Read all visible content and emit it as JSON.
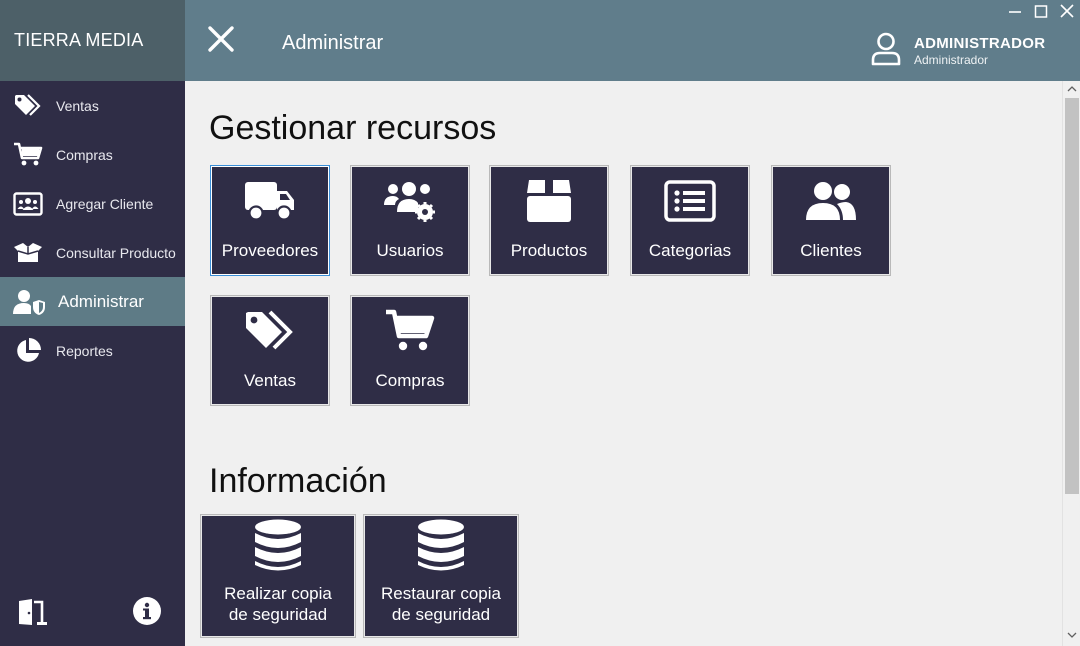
{
  "sidebar": {
    "brand": "TIERRA MEDIA",
    "items": [
      {
        "label": "Ventas",
        "icon": "tags-icon"
      },
      {
        "label": "Compras",
        "icon": "cart-icon"
      },
      {
        "label": "Agregar Cliente",
        "icon": "address-card-icon"
      },
      {
        "label": "Consultar Producto",
        "icon": "open-box-icon"
      },
      {
        "label": "Administrar",
        "icon": "user-shield-icon",
        "active": true
      },
      {
        "label": "Reportes",
        "icon": "pie-chart-icon"
      }
    ],
    "bottom_icons": [
      "exit-door-icon",
      "info-icon"
    ]
  },
  "header": {
    "title": "Administrar",
    "user_name": "ADMINISTRADOR",
    "user_role": "Administrador"
  },
  "sections": {
    "resources": {
      "title": "Gestionar recursos",
      "tiles": [
        {
          "label": "Proveedores",
          "icon": "truck-icon"
        },
        {
          "label": "Usuarios",
          "icon": "users-cog-icon"
        },
        {
          "label": "Productos",
          "icon": "box-icon"
        },
        {
          "label": "Categorias",
          "icon": "list-icon"
        },
        {
          "label": "Clientes",
          "icon": "user-friends-icon"
        },
        {
          "label": "Ventas",
          "icon": "tags-icon"
        },
        {
          "label": "Compras",
          "icon": "cart-icon"
        }
      ]
    },
    "info": {
      "title": "Información",
      "tiles": [
        {
          "label": "Realizar copia de seguridad",
          "icon": "database-icon"
        },
        {
          "label": "Restaurar copia de seguridad",
          "icon": "database-icon"
        }
      ]
    }
  },
  "colors": {
    "sidebar": "#2f2d46",
    "header": "#607d8b",
    "brand_bg": "#4d6068",
    "active_item": "#5e7b86",
    "tile": "#2f2d46"
  }
}
